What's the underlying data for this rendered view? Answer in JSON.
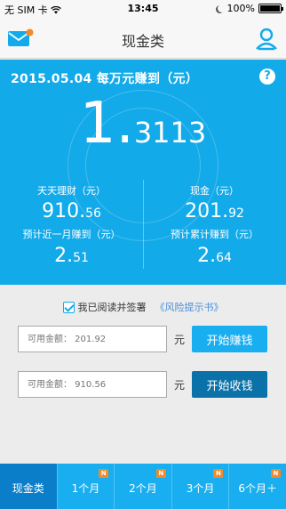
{
  "status_bar": {
    "carrier": "无 SIM 卡",
    "time": "13:45",
    "battery": "100%"
  },
  "nav": {
    "title": "现金类"
  },
  "hero": {
    "date_heading": "2015.05.04 每万元赚到（元）",
    "help": "?",
    "earnings_int": "1.",
    "earnings_dec": "3113",
    "left": {
      "label": "天天理财（元）",
      "value_int": "910.",
      "value_dec": "56",
      "sub_label": "预计近一月赚到（元）",
      "sub_int": "2.",
      "sub_dec": "51"
    },
    "right": {
      "label": "现金（元）",
      "value_int": "201.",
      "value_dec": "92",
      "sub_label": "预计累计赚到（元）",
      "sub_int": "2.",
      "sub_dec": "64"
    }
  },
  "agreement": {
    "text": "我已阅读并签署",
    "link": "《风险提示书》"
  },
  "form": {
    "earn": {
      "placeholder": "可用金额： 201.92",
      "unit": "元",
      "button": "开始赚钱",
      "button_color": "#18aef0"
    },
    "collect": {
      "placeholder": "可用金额： 910.56",
      "unit": "元",
      "button": "开始收钱",
      "button_color": "#0a72a8"
    }
  },
  "tabs": [
    {
      "label": "现金类",
      "badge": "",
      "active": true
    },
    {
      "label": "1个月",
      "badge": "N",
      "active": false
    },
    {
      "label": "2个月",
      "badge": "N",
      "active": false
    },
    {
      "label": "3个月",
      "badge": "N",
      "active": false
    },
    {
      "label": "6个月＋",
      "badge": "N",
      "active": false
    }
  ],
  "colors": {
    "accent": "#13aaea",
    "badge": "#f08a2a",
    "active_tab": "#0a7ec9"
  }
}
